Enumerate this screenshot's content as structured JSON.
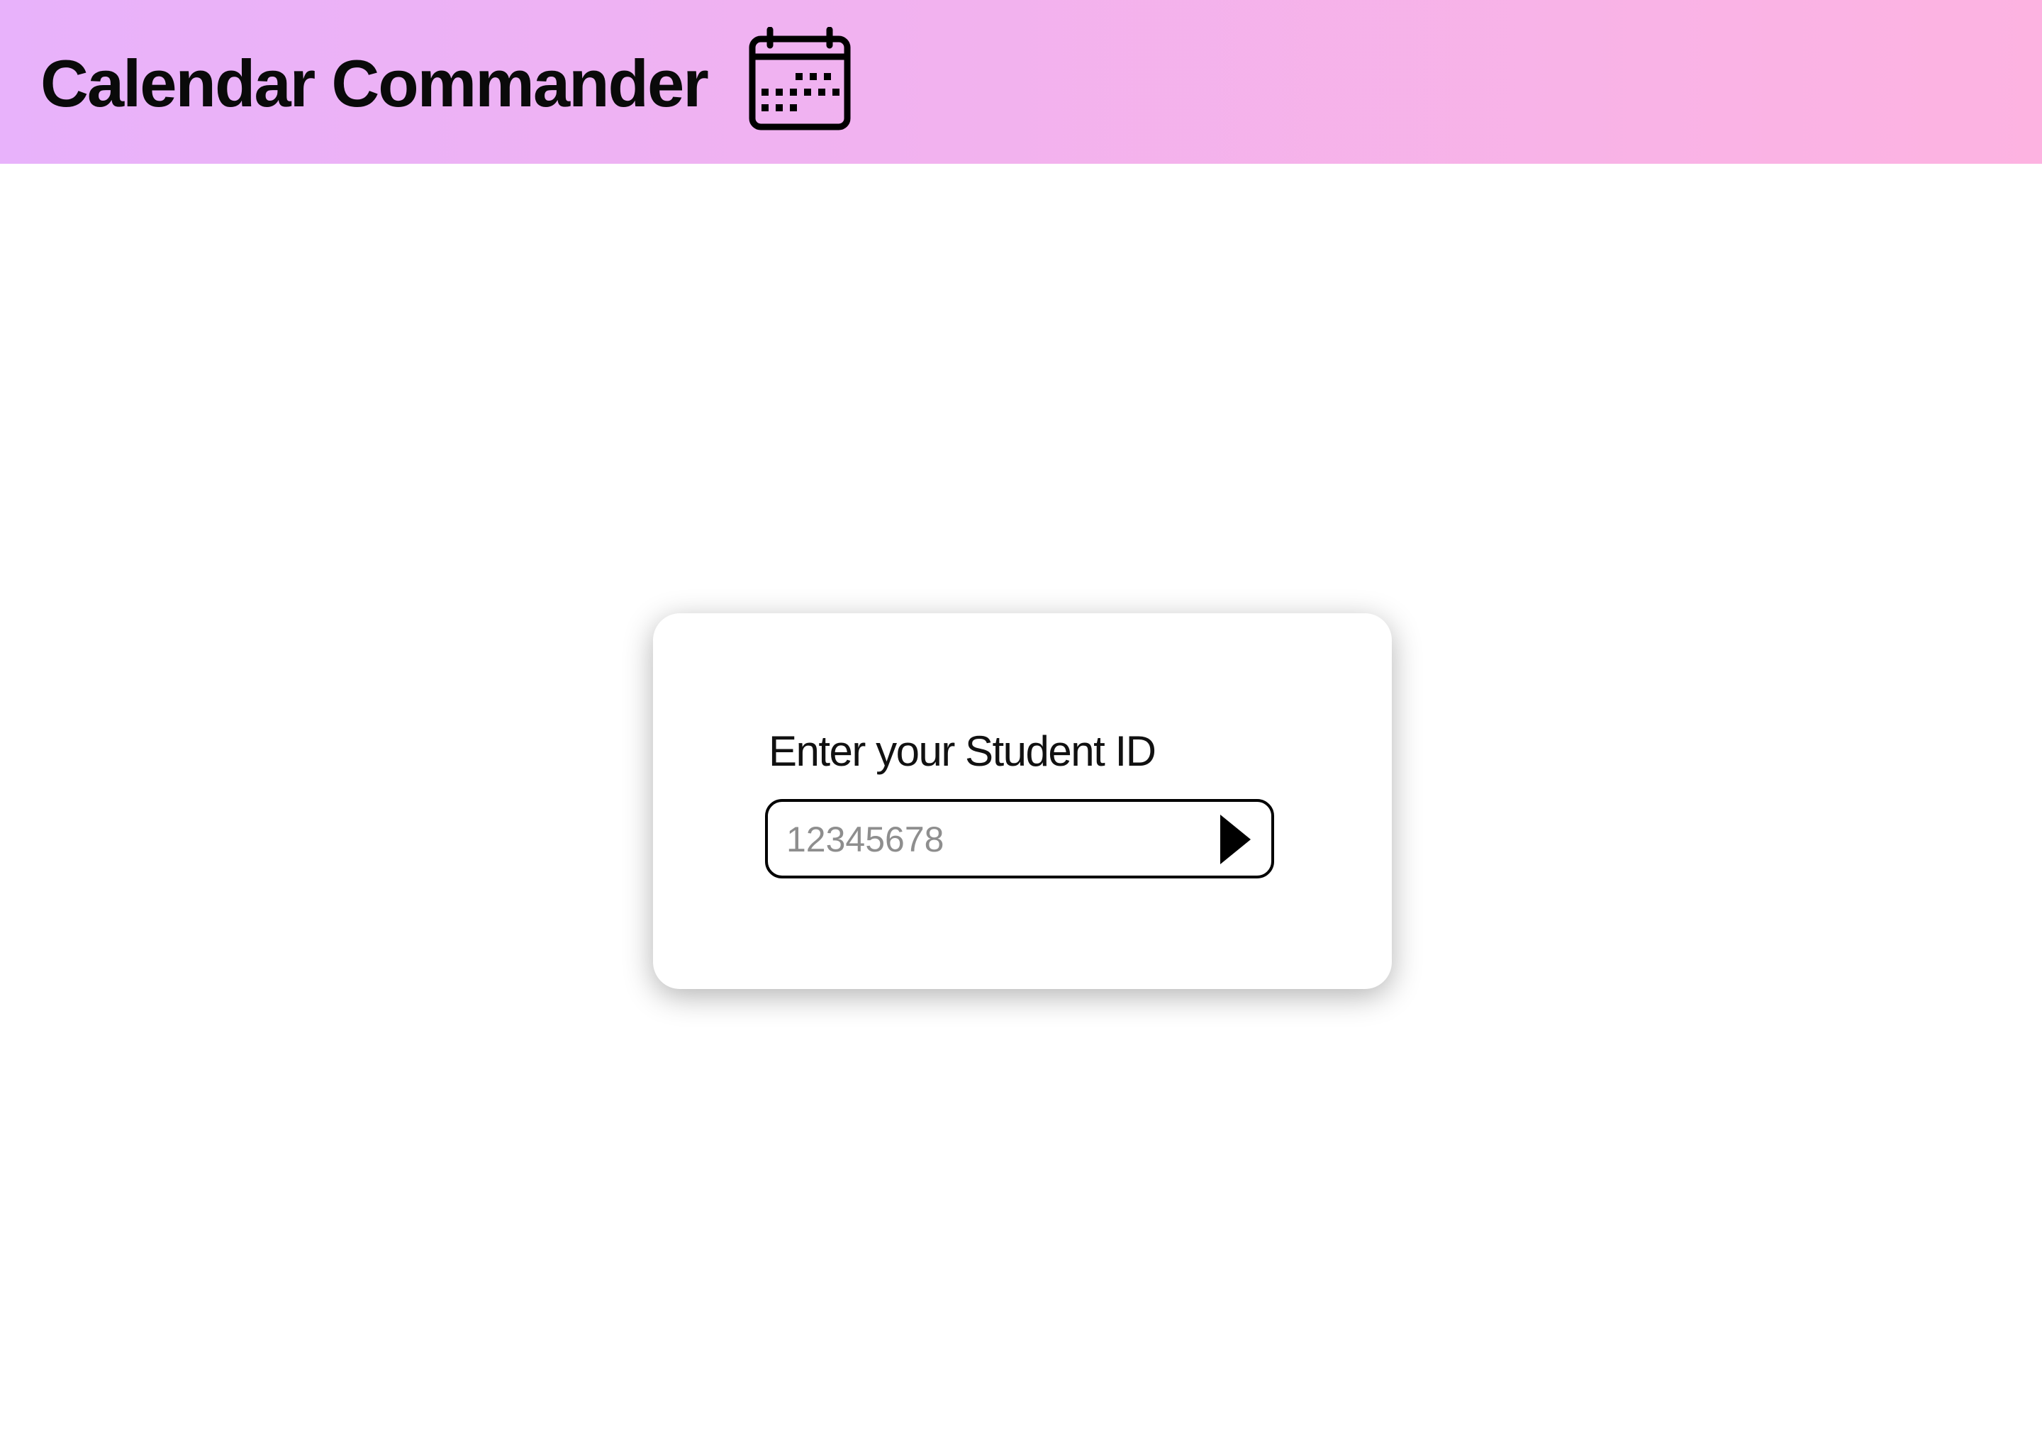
{
  "header": {
    "title": "Calendar Commander",
    "icon": "calendar-icon",
    "gradient_start": "#e8b2fb",
    "gradient_end": "#fdb3e1"
  },
  "login_card": {
    "label": "Enter your Student ID",
    "input_placeholder": "12345678",
    "input_value": "",
    "submit_icon": "play-arrow-icon"
  }
}
